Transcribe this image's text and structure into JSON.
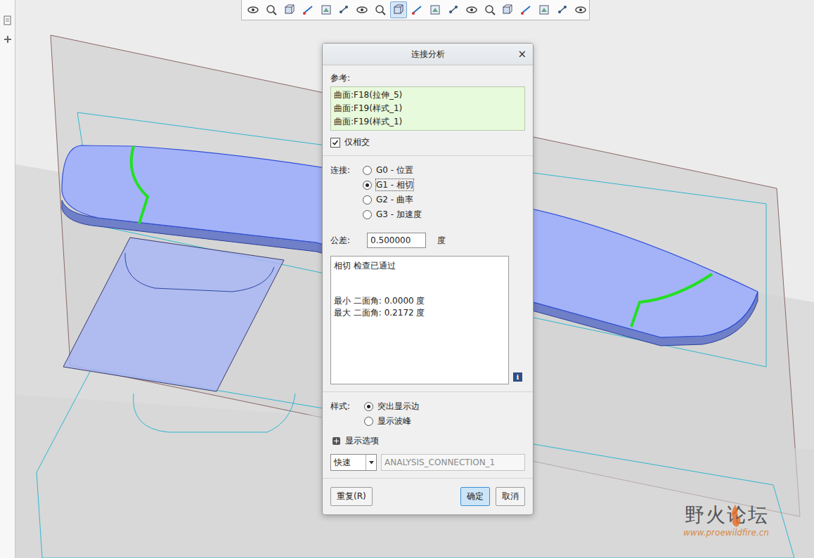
{
  "toolbar": {
    "buttons": [
      {
        "selected": false
      },
      {
        "selected": false
      },
      {
        "selected": false
      },
      {
        "selected": false
      },
      {
        "selected": false
      },
      {
        "selected": false
      },
      {
        "selected": false
      },
      {
        "selected": false
      },
      {
        "selected": true
      },
      {
        "selected": false
      },
      {
        "selected": false
      },
      {
        "selected": false
      },
      {
        "selected": false
      },
      {
        "selected": false
      },
      {
        "selected": false
      },
      {
        "selected": false
      },
      {
        "selected": false
      },
      {
        "selected": false
      },
      {
        "selected": false
      }
    ]
  },
  "dialog": {
    "title": "连接分析",
    "close": "×",
    "reference": {
      "label": "参考:",
      "items": [
        "曲面:F18(拉伸_5)",
        "曲面:F19(样式_1)",
        "曲面:F19(样式_1)"
      ]
    },
    "intersect_only": {
      "label": "仅相交",
      "checked": true
    },
    "connection": {
      "label": "连接:",
      "options": [
        {
          "label": "G0 - 位置",
          "selected": false
        },
        {
          "label": "G1 - 相切",
          "selected": true
        },
        {
          "label": "G2 - 曲率",
          "selected": false
        },
        {
          "label": "G3 - 加速度",
          "selected": false
        }
      ]
    },
    "tolerance": {
      "label": "公差:",
      "value": "0.500000",
      "unit": "度"
    },
    "result": {
      "status": "相切 检查已通过",
      "lines": [
        "最小 二面角: 0.0000 度",
        "最大 二面角: 0.2172 度"
      ],
      "info": "i"
    },
    "style": {
      "label": "样式:",
      "options": [
        {
          "label": "突出显示边",
          "selected": true
        },
        {
          "label": "显示波峰",
          "selected": false
        }
      ]
    },
    "display_options": {
      "label": "显示选项",
      "expanded": false
    },
    "quality": {
      "value": "快速"
    },
    "name": {
      "value": "ANALYSIS_CONNECTION_1",
      "disabled": true
    },
    "buttons": [
      {
        "label": "重复(R)",
        "primary": false
      },
      {
        "label": "确定",
        "primary": true
      },
      {
        "label": "取消",
        "primary": false
      }
    ]
  },
  "watermark": {
    "title": "野火论坛",
    "url": "www.proewildfire.cn"
  }
}
